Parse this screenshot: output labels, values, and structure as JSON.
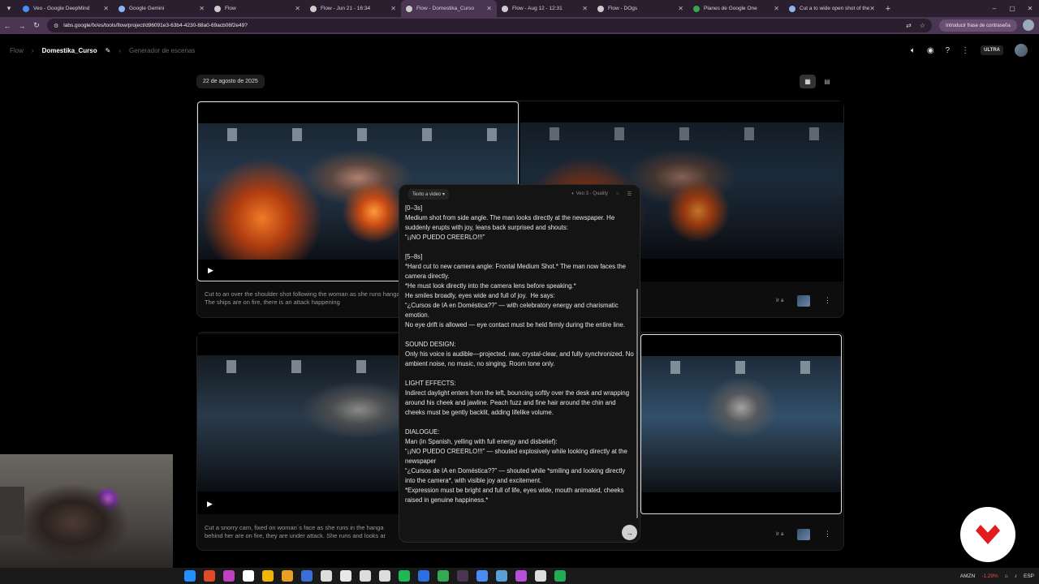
{
  "browser": {
    "tabs": [
      {
        "label": "Veo - Google DeepMind",
        "fav_color": "#4b8bf5",
        "active": false
      },
      {
        "label": "Google Gemini",
        "fav_color": "#8ab4f8",
        "active": false
      },
      {
        "label": "Flow",
        "fav_color": "#cccccc",
        "active": false
      },
      {
        "label": "Flow - Jun 21 - 16:34",
        "fav_color": "#cccccc",
        "active": false
      },
      {
        "label": "Flow - Domestika_Curso",
        "fav_color": "#cccccc",
        "active": true
      },
      {
        "label": "Flow - Aug 12 - 12:31",
        "fav_color": "#cccccc",
        "active": false
      },
      {
        "label": "Flow - DOgs",
        "fav_color": "#cccccc",
        "active": false
      },
      {
        "label": "Planes de Google One",
        "fav_color": "#34a853",
        "active": false
      },
      {
        "label": "Cut a to wide open shot of the",
        "fav_color": "#8ab4f8",
        "active": false
      }
    ],
    "url": "labs.google/fx/es/tools/flow/project/d96091e3-63b4-4230-88a0-69acb06f2e49?",
    "password_chip": "Introducir frase de contraseña"
  },
  "header": {
    "breadcrumbs": [
      "Flow",
      "Domestika_Curso",
      "Generador de escenas"
    ],
    "plan_badge": "ULTRA"
  },
  "date_label": "22 de agosto de 2025",
  "clips": [
    {
      "description": "Cut to an over the shoulder shot following the woman as she runs hangar. The ships are on fire, there is an attack happening",
      "goto_label": "Ir a"
    },
    {
      "description": "Cut a snorry cam, fixed on woman´s face as she runs in the hanga behind her are on fire, they are under attack. She runs and looks ar",
      "goto_label": "Ir a"
    }
  ],
  "prompt_panel": {
    "mode": "Texto a video",
    "model": "Veo 3 - Quality",
    "lines": [
      {
        "text": "[0–3s]",
        "gap": false
      },
      {
        "text": "Medium shot from side angle. The man looks directly at the newspaper. He suddenly erupts with joy, leans back surprised and shouts:",
        "gap": false
      },
      {
        "text": "“¡¡NO PUEDO CREERLO!!!”",
        "gap": false
      },
      {
        "text": "[5–8s]",
        "gap": true
      },
      {
        "text": "*Hard cut to new camera angle: Frontal Medium Shot.* The man now faces the camera directly.",
        "gap": false
      },
      {
        "text": "*He must look directly into the camera lens before speaking.*",
        "gap": false
      },
      {
        "text": "He smiles broadly, eyes wide and full of joy.  He says:",
        "gap": false
      },
      {
        "text": "“¿Cursos de IA en Doméstica??” — with celebratory energy and charismatic emotion.",
        "gap": false
      },
      {
        "text": "No eye drift is allowed — eye contact must be held firmly during the entire line.",
        "gap": false
      },
      {
        "text": "SOUND DESIGN:",
        "gap": true
      },
      {
        "text": "Only his voice is audible—projected, raw, crystal-clear, and fully synchronized. No ambient noise, no music, no singing. Room tone only.",
        "gap": false
      },
      {
        "text": "LIGHT EFFECTS:",
        "gap": true
      },
      {
        "text": "Indirect daylight enters from the left, bouncing softly over the desk and wrapping around his cheek and jawline. Peach fuzz and fine hair around the chin and cheeks must be gently backlit, adding lifelike volume.",
        "gap": false
      },
      {
        "text": "DIALOGUE:",
        "gap": true
      },
      {
        "text": "Man (in Spanish, yelling with full energy and disbelief):",
        "gap": false
      },
      {
        "text": "“¡¡NO PUEDO CREERLO!!!” — shouted explosively while looking directly at the newspaper",
        "gap": false
      },
      {
        "text": "“¿Cursos de IA en Doméstica??” — shouted while *smiling and looking directly into the camera*, with visible joy and excitement.",
        "gap": false
      },
      {
        "text": "*Expression must be bright and full of life, eyes wide, mouth animated, cheeks raised in genuine happiness.*",
        "gap": false
      }
    ]
  },
  "taskbar": {
    "icon_colors": [
      "#1e90ff",
      "#e04a2a",
      "#c040c0",
      "#ffffff",
      "#f4b400",
      "#e8a020",
      "#3b6fd8",
      "#dddddd",
      "#e8e8e8",
      "#dddddd",
      "#dddddd",
      "#1db954",
      "#2b6fe0",
      "#34a853",
      "#4a3552",
      "#4b8bf5",
      "#5aa0d8",
      "#b84fd8",
      "#dddddd",
      "#22aa55"
    ],
    "stock_ticker": "AMZN",
    "stock_change": "-1.29%",
    "lang": "ESP"
  },
  "colors": {
    "accent_tab": "#4a3552",
    "brand_badge": "#e11d1d"
  }
}
